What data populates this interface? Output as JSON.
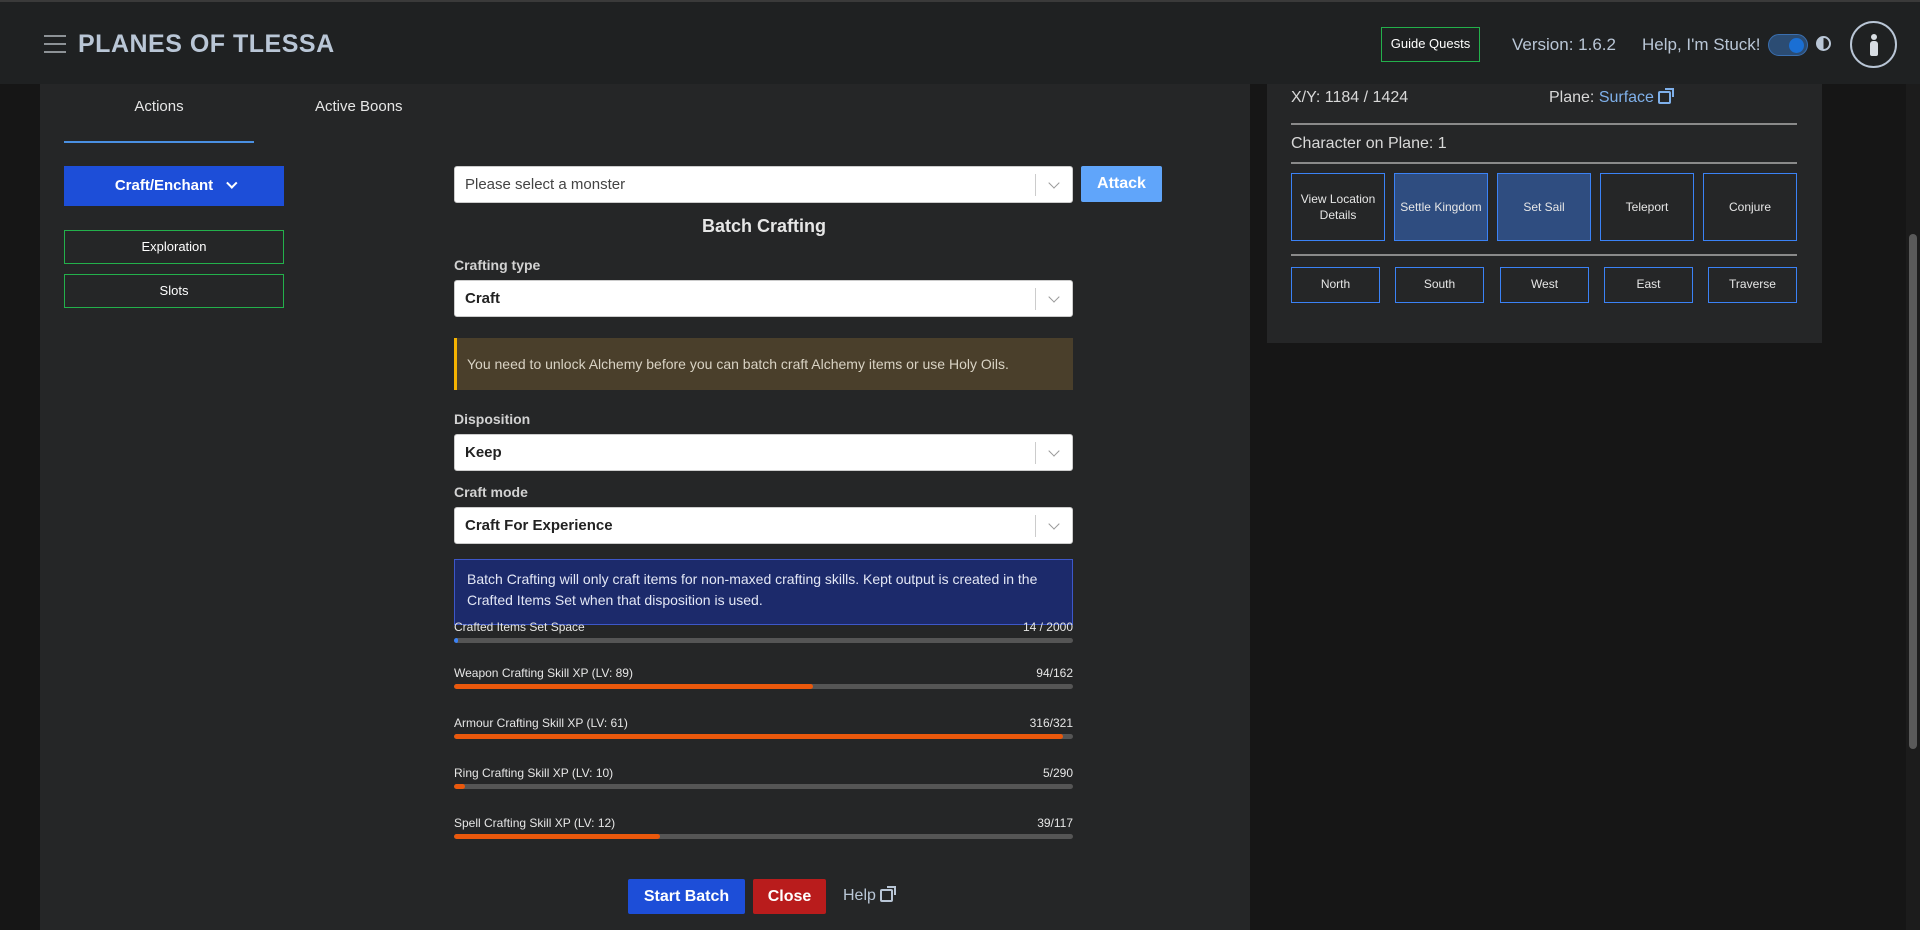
{
  "header": {
    "title": "PLANES OF TLESSA",
    "guide_quests": "Guide Quests",
    "version": "Version: 1.6.2",
    "stuck": "Help, I'm Stuck!"
  },
  "tabs": {
    "actions": "Actions",
    "boons": "Active Boons"
  },
  "sidebar": {
    "craft_enchant": "Craft/Enchant",
    "exploration": "Exploration",
    "slots": "Slots"
  },
  "monster": {
    "placeholder": "Please select a monster",
    "attack": "Attack"
  },
  "batch": {
    "title": "Batch Crafting",
    "crafting_type_label": "Crafting type",
    "crafting_type_value": "Craft",
    "warning": "You need to unlock Alchemy before you can batch craft Alchemy items or use Holy Oils.",
    "disposition_label": "Disposition",
    "disposition_value": "Keep",
    "craft_mode_label": "Craft mode",
    "craft_mode_value": "Craft For Experience",
    "info": "Batch Crafting will only craft items for non-maxed crafting skills. Kept output is created in the Crafted Items Set when that disposition is used."
  },
  "bars": [
    {
      "label": "Crafted Items Set Space",
      "value": "14 / 2000",
      "fraction": 0.007,
      "color": "#3b82f6"
    },
    {
      "label": "Weapon Crafting Skill XP (LV: 89)",
      "value": "94/162",
      "fraction": 0.58,
      "color": "#ea580c"
    },
    {
      "label": "Armour Crafting Skill XP (LV: 61)",
      "value": "316/321",
      "fraction": 0.984,
      "color": "#ea580c"
    },
    {
      "label": "Ring Crafting Skill XP (LV: 10)",
      "value": "5/290",
      "fraction": 0.017,
      "color": "#ea580c"
    },
    {
      "label": "Spell Crafting Skill XP (LV: 12)",
      "value": "39/117",
      "fraction": 0.333,
      "color": "#ea580c"
    }
  ],
  "footer": {
    "start": "Start Batch",
    "close": "Close",
    "help": "Help"
  },
  "map": {
    "coords": "X/Y: 1184 / 1424",
    "plane_label": "Plane: ",
    "plane_value": "Surface",
    "char_on_plane": "Character on Plane: 1",
    "actions": [
      "View Location Details",
      "Settle Kingdom",
      "Set Sail",
      "Teleport",
      "Conjure"
    ],
    "directions": [
      "North",
      "South",
      "West",
      "East",
      "Traverse"
    ]
  }
}
